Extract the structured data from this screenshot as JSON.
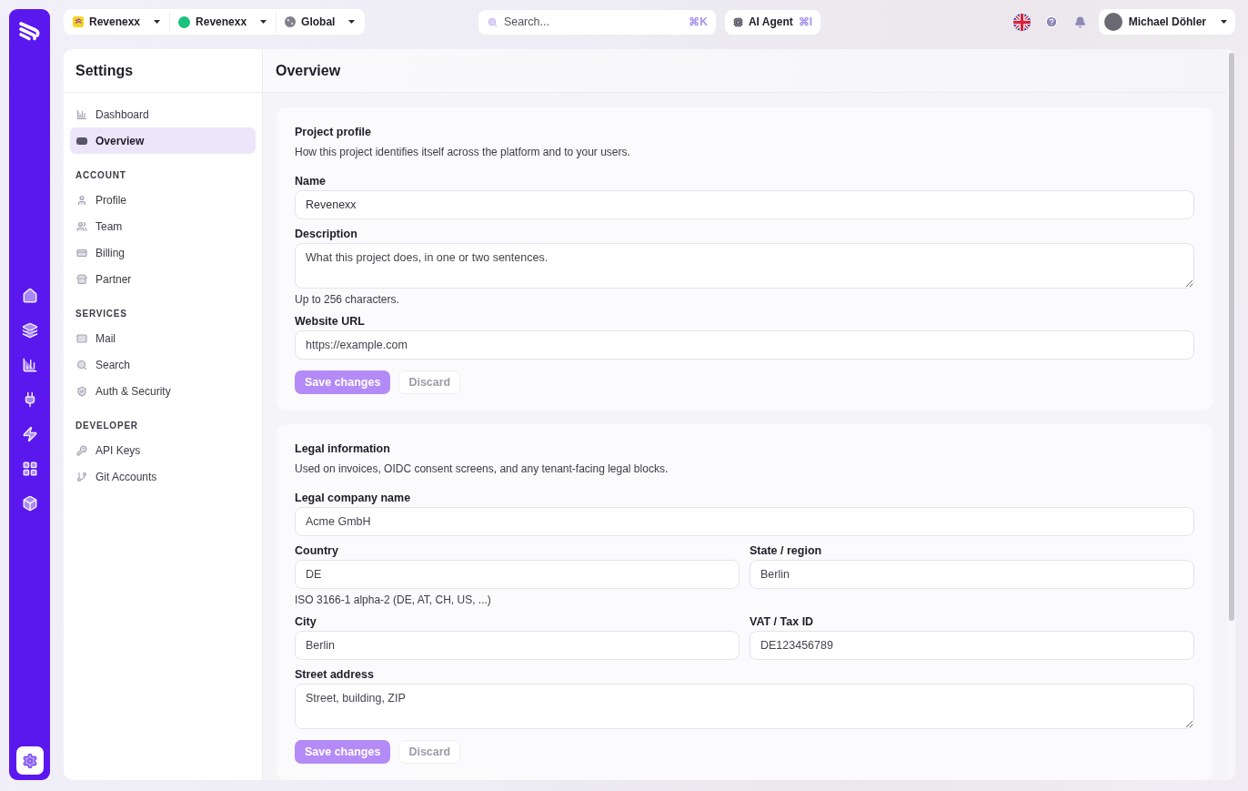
{
  "rail": {
    "items": [
      {
        "selected": false
      },
      {
        "selected": false
      },
      {
        "selected": false
      },
      {
        "selected": false
      },
      {
        "selected": false
      },
      {
        "selected": false
      },
      {
        "selected": false
      }
    ],
    "settings": {
      "selected": true
    }
  },
  "switchers": [
    {
      "kind": "logo",
      "label": "Revenexx"
    },
    {
      "kind": "dot",
      "label": "Revenexx"
    },
    {
      "kind": "globe",
      "label": "Global"
    }
  ],
  "search": {
    "placeholder": "Search...",
    "shortcut": "⌘K"
  },
  "ai_agent": {
    "label": "AI Agent",
    "shortcut": "⌘I"
  },
  "user_menu": {
    "name": "Michael Döhler"
  },
  "settings_nav": {
    "title": "Settings",
    "sections": [
      {
        "items": [
          {
            "label": "Dashboard",
            "selected": false
          },
          {
            "label": "Overview",
            "selected": true
          }
        ]
      },
      {
        "heading": "ACCOUNT",
        "items": [
          {
            "label": "Profile",
            "selected": false
          },
          {
            "label": "Team",
            "selected": false
          },
          {
            "label": "Billing",
            "selected": false
          },
          {
            "label": "Partner",
            "selected": false
          }
        ]
      },
      {
        "heading": "SERVICES",
        "items": [
          {
            "label": "Mail",
            "selected": false
          },
          {
            "label": "Search",
            "selected": false
          },
          {
            "label": "Auth & Security",
            "selected": false
          }
        ]
      },
      {
        "heading": "DEVELOPER",
        "items": [
          {
            "label": "API Keys",
            "selected": false
          },
          {
            "label": "Git Accounts",
            "selected": false
          }
        ]
      }
    ]
  },
  "page": {
    "title": "Overview",
    "cards": [
      {
        "title": "Project profile",
        "description": "How this project identifies itself across the platform and to your users.",
        "rows": [
          {
            "fields": [
              {
                "kind": "input",
                "label": "Name",
                "value": "Revenexx"
              }
            ]
          },
          {
            "fields": [
              {
                "kind": "textarea",
                "label": "Description",
                "placeholder": "What this project does, in one or two sentences.",
                "hint": "Up to 256 characters."
              }
            ]
          },
          {
            "fields": [
              {
                "kind": "input",
                "label": "Website URL",
                "placeholder": "https://example.com"
              }
            ]
          }
        ],
        "actions": [
          {
            "kind": "save",
            "label": "Save changes",
            "disabled": true
          },
          {
            "kind": "discard",
            "label": "Discard",
            "disabled": true
          }
        ]
      },
      {
        "title": "Legal information",
        "description": "Used on invoices, OIDC consent screens, and any tenant-facing legal blocks.",
        "rows": [
          {
            "fields": [
              {
                "kind": "input",
                "label": "Legal company name",
                "placeholder": "Acme GmbH"
              }
            ]
          },
          {
            "fields": [
              {
                "kind": "input",
                "label": "Country",
                "placeholder": "DE",
                "hint": "ISO 3166-1 alpha-2 (DE, AT, CH, US, ...)"
              },
              {
                "kind": "input",
                "label": "State / region",
                "placeholder": "Berlin"
              }
            ]
          },
          {
            "fields": [
              {
                "kind": "input",
                "label": "City",
                "placeholder": "Berlin"
              },
              {
                "kind": "input",
                "label": "VAT / Tax ID",
                "placeholder": "DE123456789"
              }
            ]
          },
          {
            "fields": [
              {
                "kind": "textarea",
                "label": "Street address",
                "placeholder": "Street, building, ZIP"
              }
            ]
          }
        ],
        "actions": [
          {
            "kind": "save",
            "label": "Save changes",
            "disabled": true
          },
          {
            "kind": "discard",
            "label": "Discard",
            "disabled": true
          }
        ]
      }
    ]
  }
}
